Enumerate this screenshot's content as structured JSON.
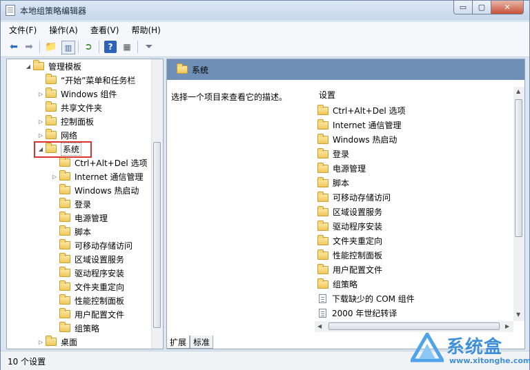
{
  "window": {
    "title": "本地组策略编辑器",
    "min": "▭",
    "max": "▢",
    "close": "✕"
  },
  "menu": [
    "文件(F)",
    "操作(A)",
    "查看(V)",
    "帮助(H)"
  ],
  "toolbar_icons": [
    "back-icon",
    "forward-icon",
    "up-folder-icon",
    "show-hide-tree-icon",
    "export-list-icon",
    "help-icon",
    "properties-icon",
    "filter-icon"
  ],
  "tree": [
    {
      "label": "管理模板",
      "tri": "◢"
    },
    {
      "label": "“开始”菜单和任务栏",
      "tri": ""
    },
    {
      "label": "Windows 组件",
      "tri": "▷"
    },
    {
      "label": "共享文件夹",
      "tri": ""
    },
    {
      "label": "控制面板",
      "tri": "▷"
    },
    {
      "label": "网络",
      "tri": "▷"
    },
    {
      "label": "系统",
      "tri": "◢"
    },
    {
      "label": "Ctrl+Alt+Del 选项",
      "tri": ""
    },
    {
      "label": "Internet 通信管理",
      "tri": "▷"
    },
    {
      "label": "Windows 热启动",
      "tri": ""
    },
    {
      "label": "登录",
      "tri": ""
    },
    {
      "label": "电源管理",
      "tri": ""
    },
    {
      "label": "脚本",
      "tri": ""
    },
    {
      "label": "可移动存储访问",
      "tri": ""
    },
    {
      "label": "区域设置服务",
      "tri": ""
    },
    {
      "label": "驱动程序安装",
      "tri": ""
    },
    {
      "label": "文件夹重定向",
      "tri": ""
    },
    {
      "label": "性能控制面板",
      "tri": ""
    },
    {
      "label": "用户配置文件",
      "tri": ""
    },
    {
      "label": "组策略",
      "tri": ""
    },
    {
      "label": "桌面",
      "tri": "▷"
    }
  ],
  "right": {
    "header": "系统",
    "description": "选择一个项目来查看它的描述。",
    "column": "设置",
    "items": [
      {
        "label": "Ctrl+Alt+Del 选项",
        "kind": "folder"
      },
      {
        "label": "Internet 通信管理",
        "kind": "folder"
      },
      {
        "label": "Windows 热启动",
        "kind": "folder"
      },
      {
        "label": "登录",
        "kind": "folder"
      },
      {
        "label": "电源管理",
        "kind": "folder"
      },
      {
        "label": "脚本",
        "kind": "folder"
      },
      {
        "label": "可移动存储访问",
        "kind": "folder"
      },
      {
        "label": "区域设置服务",
        "kind": "folder"
      },
      {
        "label": "驱动程序安装",
        "kind": "folder"
      },
      {
        "label": "文件夹重定向",
        "kind": "folder"
      },
      {
        "label": "性能控制面板",
        "kind": "folder"
      },
      {
        "label": "用户配置文件",
        "kind": "folder"
      },
      {
        "label": "组策略",
        "kind": "folder"
      },
      {
        "label": "下载缺少的 COM 组件",
        "kind": "setting"
      },
      {
        "label": "2000 年世纪转译",
        "kind": "setting"
      }
    ]
  },
  "tabs": [
    "扩展",
    "标准"
  ],
  "status": "10 个设置",
  "watermark": {
    "brand": "系统盒",
    "url": "www.xitonghe.com"
  }
}
